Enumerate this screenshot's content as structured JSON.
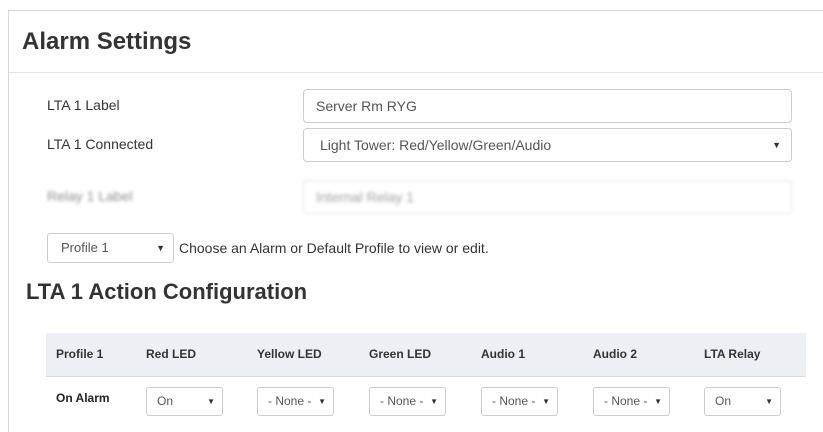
{
  "header": {
    "title": "Alarm Settings"
  },
  "form": {
    "label_field": {
      "label": "LTA 1 Label",
      "value": "Server Rm RYG"
    },
    "connected_field": {
      "label": "LTA 1 Connected",
      "value": "Light Tower: Red/Yellow/Green/Audio"
    },
    "relay_field": {
      "label": "Relay 1 Label",
      "value": "Internal Relay 1"
    }
  },
  "profile": {
    "selected": "Profile 1",
    "help_text": "Choose an Alarm or Default Profile to view or edit."
  },
  "action_config": {
    "title": "LTA 1 Action Configuration",
    "columns": [
      "Profile 1",
      "Red LED",
      "Yellow LED",
      "Green LED",
      "Audio 1",
      "Audio 2",
      "LTA Relay"
    ],
    "rows": [
      {
        "label": "On Alarm",
        "values": [
          "On",
          "- None -",
          "- None -",
          "- None -",
          "- None -",
          "On"
        ]
      }
    ]
  },
  "icons": {
    "dropdown": "caret-down-icon"
  }
}
